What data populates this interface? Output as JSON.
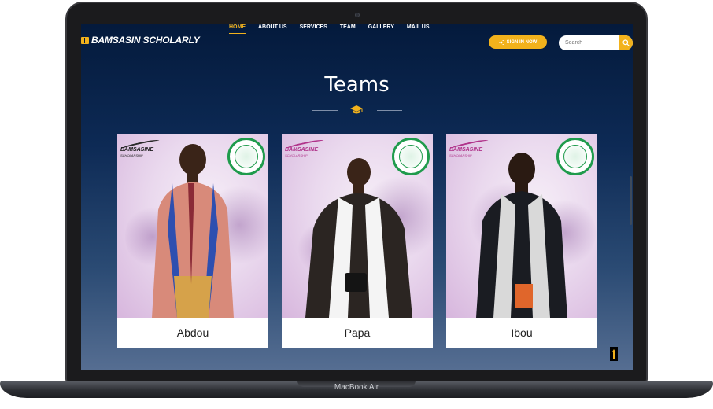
{
  "device": {
    "label": "MacBook Air"
  },
  "brand": {
    "name": "BAMSASIN SCHOLARLY"
  },
  "nav": {
    "items": [
      {
        "label": "HOME",
        "active": true
      },
      {
        "label": "ABOUT US",
        "active": false
      },
      {
        "label": "SERVICES",
        "active": false
      },
      {
        "label": "TEAM",
        "active": false
      },
      {
        "label": "GALLERY",
        "active": false
      },
      {
        "label": "MAIL US",
        "active": false
      }
    ],
    "signin_label": "SIGN IN NOW",
    "search_placeholder": "Search"
  },
  "section": {
    "title": "Teams"
  },
  "team": [
    {
      "name": "Abdou",
      "logo_text": "BAMSASINE",
      "logo_sub": "SCHOLARSHIP",
      "logo_color": "#1a1a1a"
    },
    {
      "name": "Papa",
      "logo_text": "BAMSASINE",
      "logo_sub": "SCHOLARSHIP",
      "logo_color": "#b0338a"
    },
    {
      "name": "Ibou",
      "logo_text": "BAMSASINE",
      "logo_sub": "SCHOLARSHIP",
      "logo_color": "#b0338a"
    }
  ],
  "colors": {
    "accent": "#f2b21c",
    "emblem_green": "#1f9b4c",
    "background_top": "#041a3c",
    "background_bottom": "#566e92"
  },
  "icons": {
    "brand": "book-icon",
    "signin": "sign-in-icon",
    "search": "search-icon",
    "divider": "graduation-cap-icon",
    "back_to_top": "arrow-up-icon"
  }
}
